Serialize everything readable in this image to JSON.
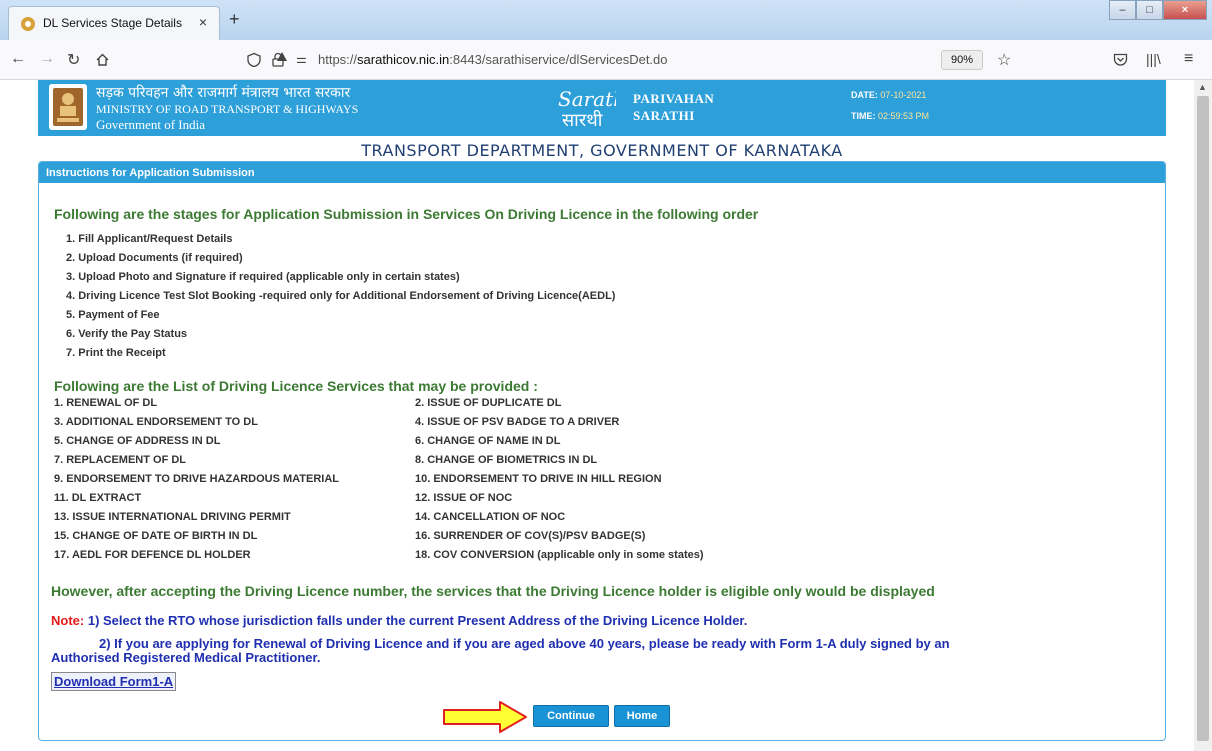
{
  "browser": {
    "tab_title": "DL Services Stage Details",
    "tab_close": "×",
    "new_tab": "+",
    "url_prefix": "https://",
    "url_host": "sarathicov.nic.in",
    "url_rest": ":8443/sarathiservice/dlServicesDet.do",
    "zoom": "90%"
  },
  "header": {
    "hindi_title": "सड़क परिवहन और राजमार्ग मंत्रालय भारत सरकार",
    "ministry": "MINISTRY OF ROAD TRANSPORT & HIGHWAYS",
    "government": "Government of India",
    "logo_parivahan": "PARIVAHAN",
    "logo_sarathi": "SARATHI",
    "date_label": "DATE:",
    "date_value": "07-10-2021",
    "time_label": "TIME:",
    "time_value": "02:59:53 PM"
  },
  "department": "TRANSPORT DEPARTMENT, GOVERNMENT OF KARNATAKA",
  "panel": {
    "heading": "Instructions for Application Submission",
    "stages_heading": "Following are the stages for Application Submission in Services On Driving Licence in the following order",
    "stages": [
      "1. Fill Applicant/Request Details",
      "2. Upload Documents (if required)",
      "3. Upload Photo and Signature if required (applicable only in certain states)",
      "4. Driving Licence Test Slot Booking -required only for Additional Endorsement of Driving Licence(AEDL)",
      "5. Payment of Fee",
      "6. Verify the Pay Status",
      "7. Print the Receipt"
    ],
    "services_heading": "Following are the List of Driving Licence Services that may be provided :",
    "services_left": [
      "1. RENEWAL OF DL",
      "3. ADDITIONAL ENDORSEMENT TO DL",
      "5. CHANGE OF ADDRESS IN DL",
      "7. REPLACEMENT OF DL",
      "9. ENDORSEMENT TO DRIVE HAZARDOUS MATERIAL",
      "11. DL EXTRACT",
      "13. ISSUE INTERNATIONAL DRIVING PERMIT",
      "15. CHANGE OF DATE OF BIRTH IN DL",
      "17. AEDL FOR DEFENCE DL HOLDER"
    ],
    "services_right": [
      "2. ISSUE OF DUPLICATE DL",
      "4. ISSUE OF PSV BADGE TO A DRIVER",
      "6. CHANGE OF NAME IN DL",
      "8. CHANGE OF BIOMETRICS IN DL",
      "10. ENDORSEMENT TO DRIVE IN HILL REGION",
      "12. ISSUE OF NOC",
      "14. CANCELLATION OF NOC",
      "16. SURRENDER OF COV(S)/PSV BADGE(S)",
      "18. COV CONVERSION (applicable only in some states)"
    ],
    "eligibility_text": "However, after accepting the Driving Licence number, the services that the Driving Licence holder is eligible only would be displayed",
    "note_label": "Note:",
    "note_1": "1) Select the RTO whose jurisdiction falls under the current Present Address of the Driving Licence Holder.",
    "note_2": "2) If you are applying for Renewal of Driving Licence and if you are aged above 40 years, please be ready with Form 1-A duly signed by an",
    "note_2_cont": "Authorised Registered Medical Practitioner.",
    "download_link": "Download Form1-A",
    "continue_button": "Continue",
    "home_button": "Home"
  },
  "colors": {
    "header_blue": "#2d9fd9",
    "heading_green": "#3c7a33",
    "note_red": "#e31a1a",
    "note_blue": "#1f2fb0",
    "arrow_yellow": "#ffff33",
    "arrow_outline": "#e02020"
  }
}
